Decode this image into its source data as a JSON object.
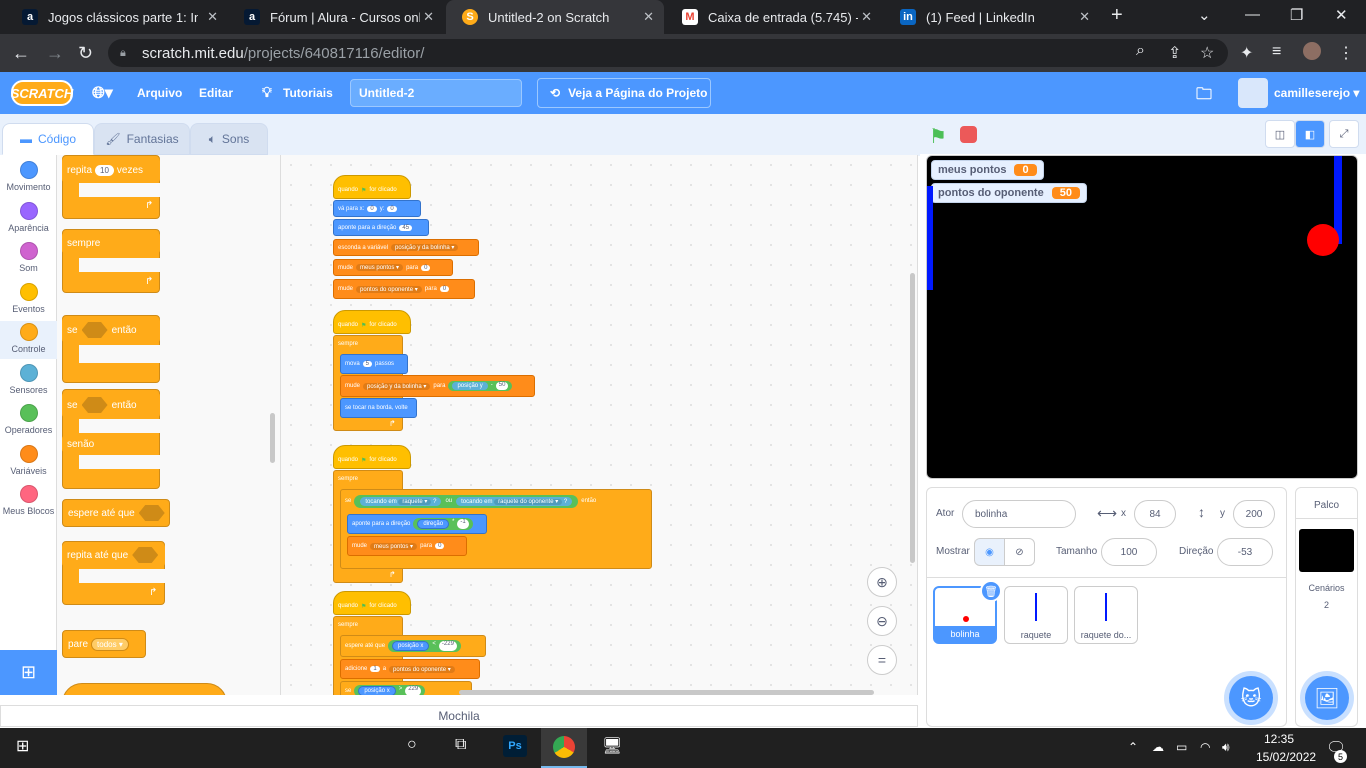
{
  "browser": {
    "tabs": [
      {
        "title": "Jogos clássicos parte 1: Inicia",
        "icon": "a"
      },
      {
        "title": "Fórum | Alura - Cursos online",
        "icon": "a"
      },
      {
        "title": "Untitled-2 on Scratch",
        "icon": "S"
      },
      {
        "title": "Caixa de entrada (5.745) - ca",
        "icon": "M"
      },
      {
        "title": "(1) Feed | LinkedIn",
        "icon": "in"
      }
    ],
    "url_host": "scratch.mit.edu",
    "url_path": "/projects/640817116/editor/"
  },
  "menu": {
    "logo": "SCRATCH",
    "file": "Arquivo",
    "edit": "Editar",
    "tutorials": "Tutoriais",
    "title": "Untitled-2",
    "see_page": "Veja a Página do Projeto",
    "user": "camilleserejo"
  },
  "editor_tabs": {
    "code": "Código",
    "costumes": "Fantasias",
    "sounds": "Sons"
  },
  "categories": [
    {
      "label": "Movimento",
      "color": "#4c97ff"
    },
    {
      "label": "Aparência",
      "color": "#9966ff"
    },
    {
      "label": "Som",
      "color": "#cf63cf"
    },
    {
      "label": "Eventos",
      "color": "#ffbf00"
    },
    {
      "label": "Controle",
      "color": "#ffab19"
    },
    {
      "label": "Sensores",
      "color": "#5cb1d6"
    },
    {
      "label": "Operadores",
      "color": "#59c059"
    },
    {
      "label": "Variáveis",
      "color": "#ff8c1a"
    },
    {
      "label": "Meus Blocos",
      "color": "#ff6680"
    }
  ],
  "palette": {
    "repeat": "repita",
    "repeat_n": "10",
    "times": "vezes",
    "forever": "sempre",
    "if": "se",
    "then": "então",
    "else": "senão",
    "wait_until": "espere até que",
    "repeat_until": "repita até que",
    "stop": "pare",
    "stop_opt": "todos"
  },
  "scripts": {
    "when_flag": "quando",
    "clicked": "for clicado",
    "forever": "sempre",
    "go_to": "vá para x:",
    "x0": "0",
    "y": "y:",
    "y0": "0",
    "point": "aponte para a direção",
    "dir45": "45",
    "hide_var": "esconda a variável",
    "var_pos": "posição y da bolinha",
    "set": "mude",
    "my_points": "meus pontos",
    "to": "para",
    "zero": "0",
    "opp_points": "pontos do oponente",
    "move": "mova",
    "steps_n": "5",
    "steps": "passos",
    "pos_y": "posição y",
    "minus": "-",
    "fifty": "50",
    "bounce": "se tocar na borda, volte",
    "if": "se",
    "touching": "tocando em",
    "paddle": "raquete",
    "q": "?",
    "or": "ou",
    "opp_paddle": "raquete do oponente",
    "then": "então",
    "point_dir": "aponte para a direção",
    "direction": "direção",
    "times": "*",
    "neg1": "-1",
    "wait_until": "espere até que",
    "pos_x": "posição x",
    "lt": "<",
    "m229": "-229",
    "add": "adicione",
    "one": "1",
    "a": "a",
    "gt": ">",
    "p229": "229"
  },
  "mochila": "Mochila",
  "stage": {
    "monitors": [
      {
        "label": "meus pontos",
        "value": "0"
      },
      {
        "label": "pontos do oponente",
        "value": "50"
      }
    ]
  },
  "sprite_info": {
    "actor_label": "Ator",
    "actor": "bolinha",
    "x_label": "x",
    "x": "84",
    "y_label": "y",
    "y": "200",
    "show_label": "Mostrar",
    "size_label": "Tamanho",
    "size": "100",
    "dir_label": "Direção",
    "dir": "-53"
  },
  "sprites": [
    {
      "name": "bolinha"
    },
    {
      "name": "raquete"
    },
    {
      "name": "raquete do..."
    }
  ],
  "palco": {
    "title": "Palco",
    "backdrops_label": "Cenários",
    "backdrops": "2"
  },
  "taskbar": {
    "time": "12:35",
    "date": "15/02/2022",
    "notif": "5"
  }
}
